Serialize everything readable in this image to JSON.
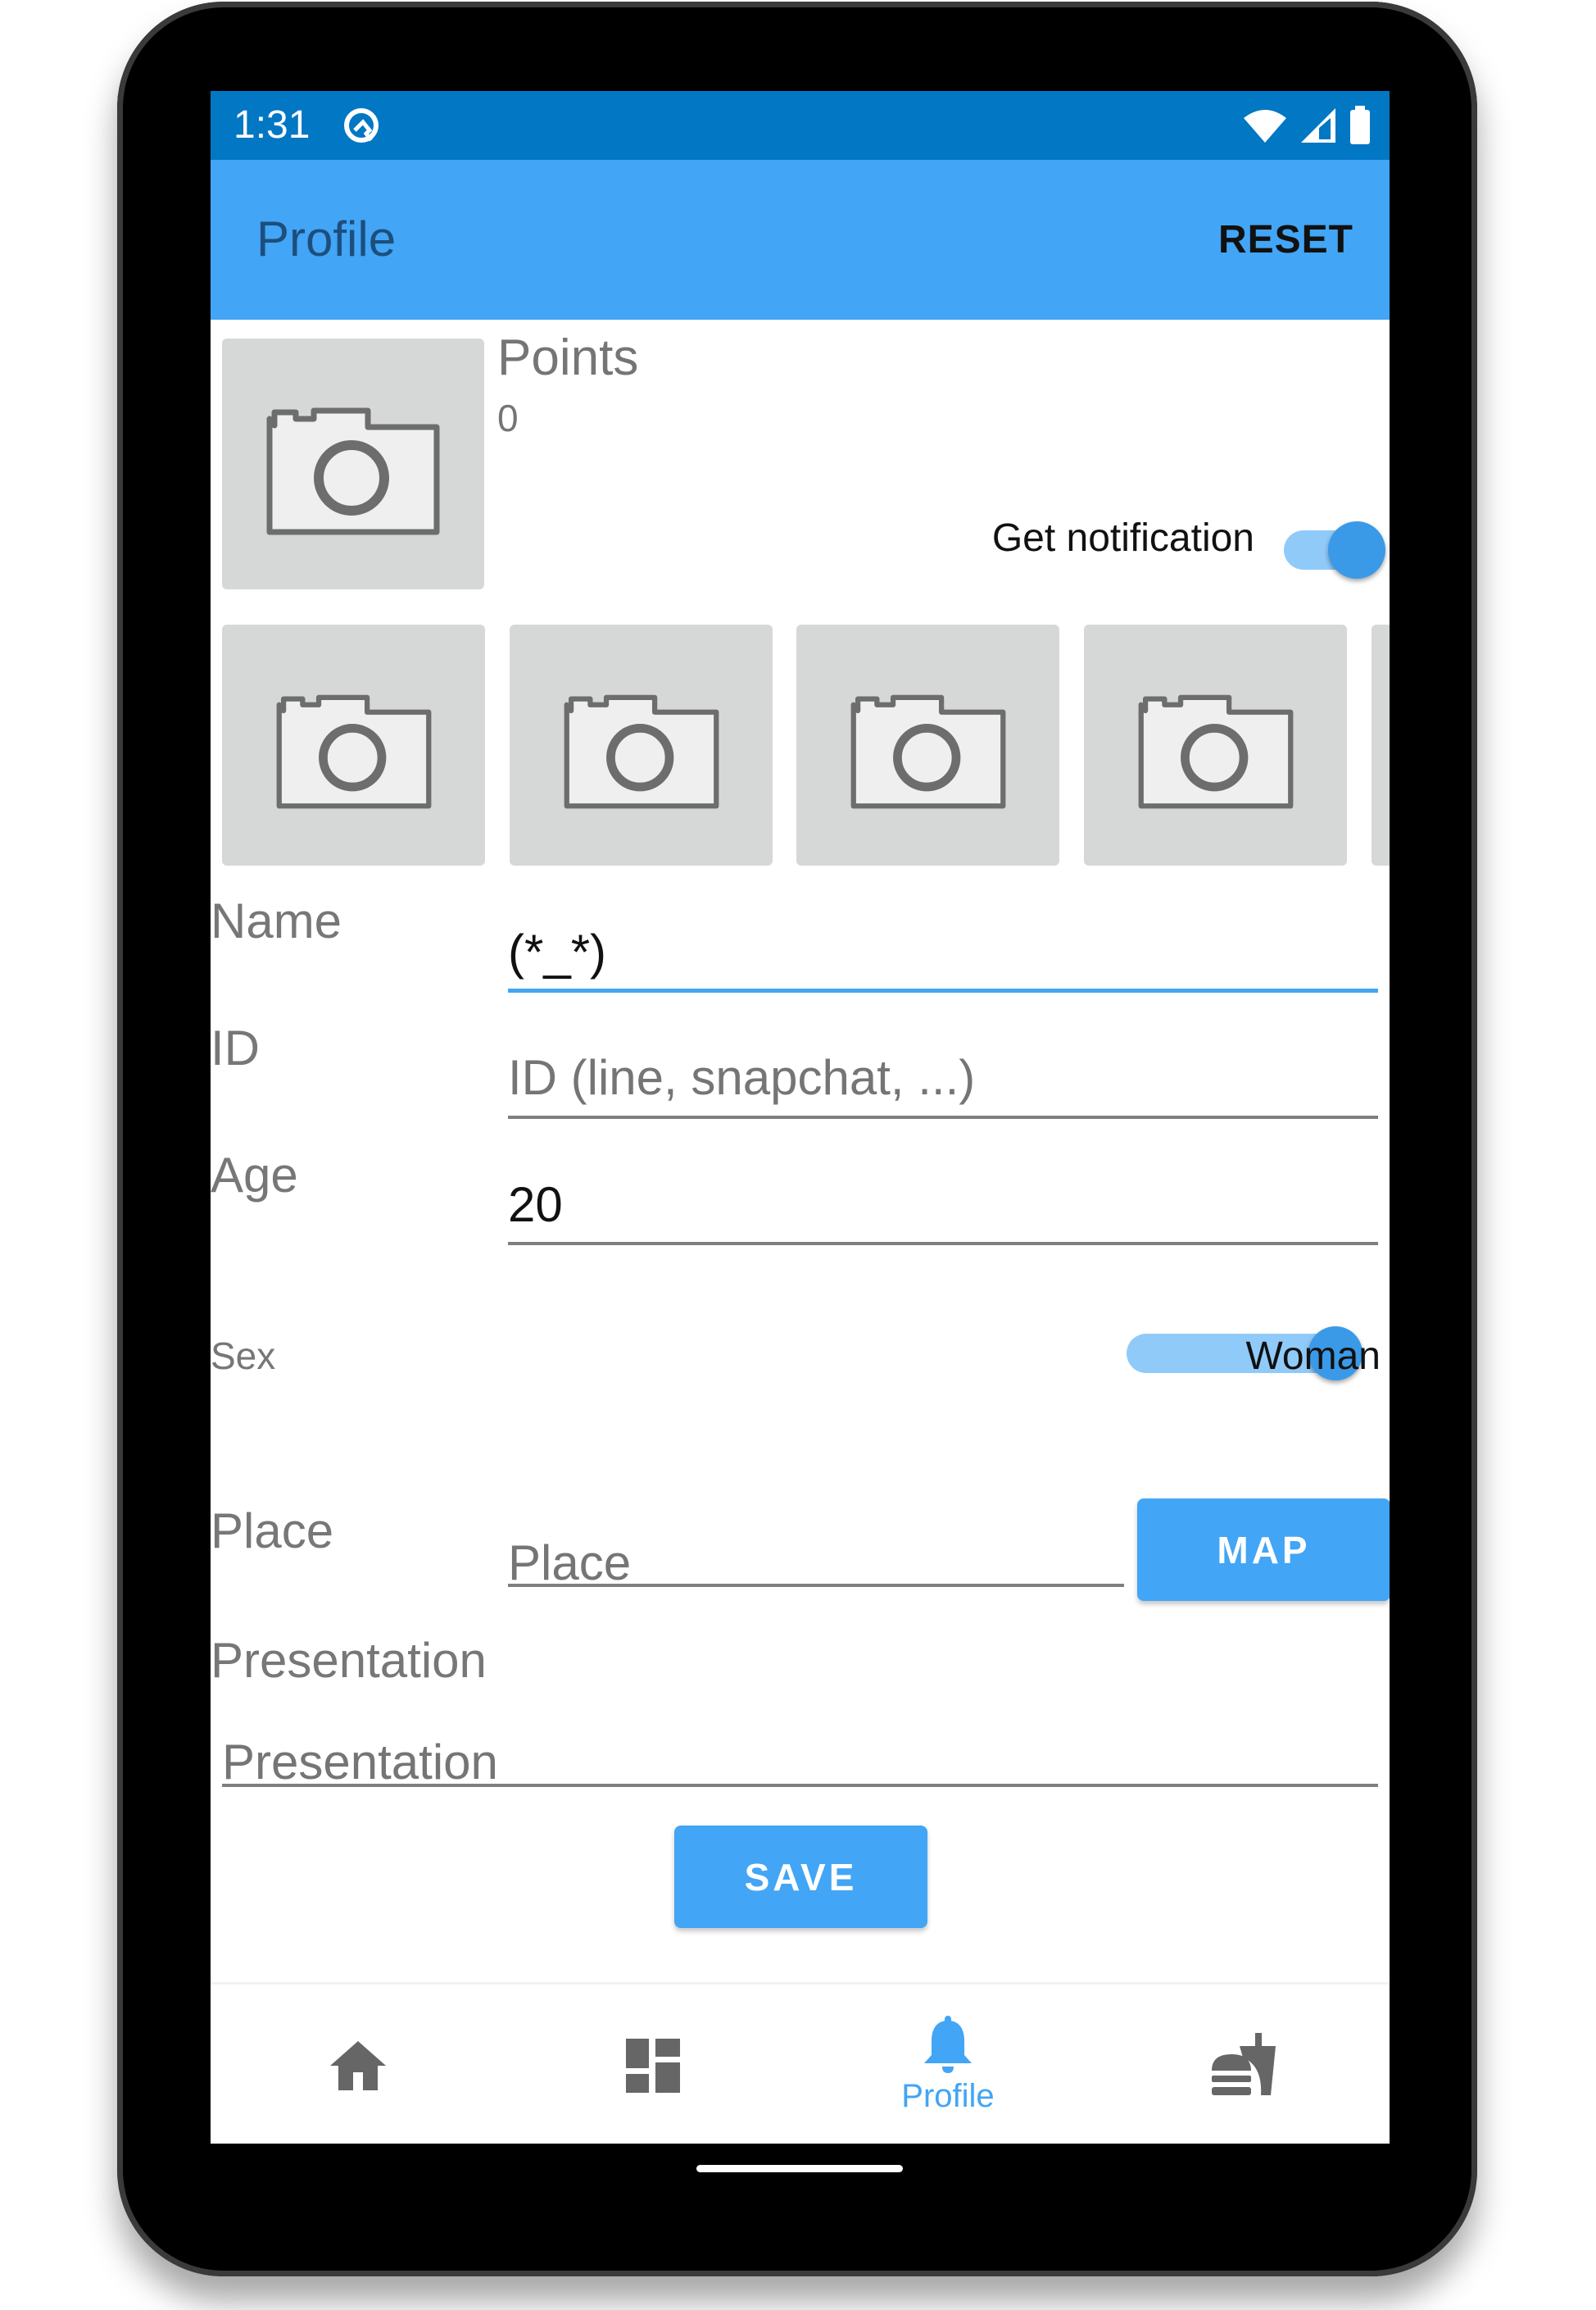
{
  "status_bar": {
    "time": "1:31",
    "left_icon": "q-launcher-icon",
    "right_icons": [
      "wifi-icon",
      "signal-icon",
      "battery-icon"
    ]
  },
  "app_bar": {
    "title": "Profile",
    "reset_label": "RESET"
  },
  "header": {
    "avatar_icon": "camera-icon",
    "points_label": "Points",
    "points_value": "0",
    "notification_label": "Get notification",
    "notification_on": true
  },
  "photos": {
    "count_visible": 5,
    "icon": "camera-icon"
  },
  "form": {
    "name": {
      "label": "Name",
      "value": "(*_*)",
      "placeholder": ""
    },
    "id": {
      "label": "ID",
      "value": "",
      "placeholder": "ID (line, snapchat, ...)"
    },
    "age": {
      "label": "Age",
      "value": "20",
      "placeholder": ""
    },
    "sex": {
      "label": "Sex",
      "value": "Woman"
    },
    "place": {
      "label": "Place",
      "value": "",
      "placeholder": "Place",
      "map_button": "MAP"
    },
    "presentation": {
      "label": "Presentation",
      "value": "",
      "placeholder": "Presentation"
    },
    "save_button": "SAVE"
  },
  "bottom_nav": {
    "items": [
      {
        "icon": "home-icon",
        "label": ""
      },
      {
        "icon": "dashboard-icon",
        "label": ""
      },
      {
        "icon": "bell-icon",
        "label": "Profile",
        "active": true
      },
      {
        "icon": "fastfood-icon",
        "label": ""
      }
    ]
  },
  "colors": {
    "status_bar": "#0277C4",
    "primary": "#42A5F5",
    "primary_light": "#90CAF9",
    "icon_gray": "#666666"
  }
}
